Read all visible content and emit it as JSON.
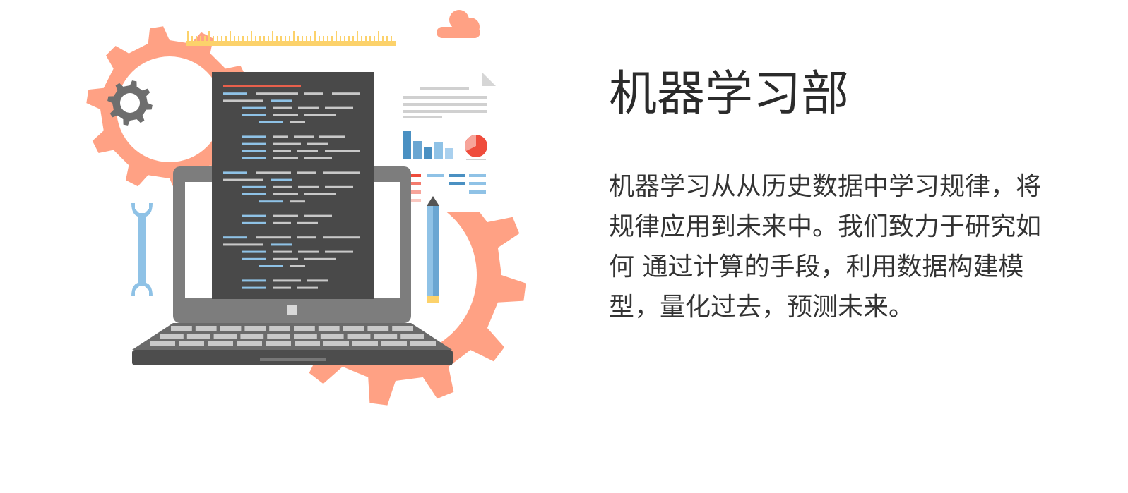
{
  "section": {
    "title": "机器学习部",
    "description": "机器学习从从历史数据中学习规律，将规律应用到未来中。我们致力于研究如何 通过计算的手段，利用数据构建模型，量化过去，预测未来。"
  },
  "illustration": {
    "icons": [
      "gear-icon",
      "small-gear-icon",
      "ruler-icon",
      "cloud-icon",
      "document-icon",
      "bar-chart-icon",
      "pie-chart-icon",
      "wrench-icon",
      "pencil-icon",
      "laptop-icon",
      "code-screen"
    ],
    "colors": {
      "gear": "#ffa184",
      "laptop_body": "#7a7a7a",
      "laptop_base": "#4d4d4d",
      "screen_dark": "#494949",
      "code_blue": "#8fc2e6",
      "code_gray": "#c8c8c8",
      "code_red": "#e8604c",
      "ruler": "#fcd26b",
      "chart_blue": "#4a90c2",
      "pie_red": "#ef4c3c",
      "wrench": "#8fc2e6"
    }
  }
}
